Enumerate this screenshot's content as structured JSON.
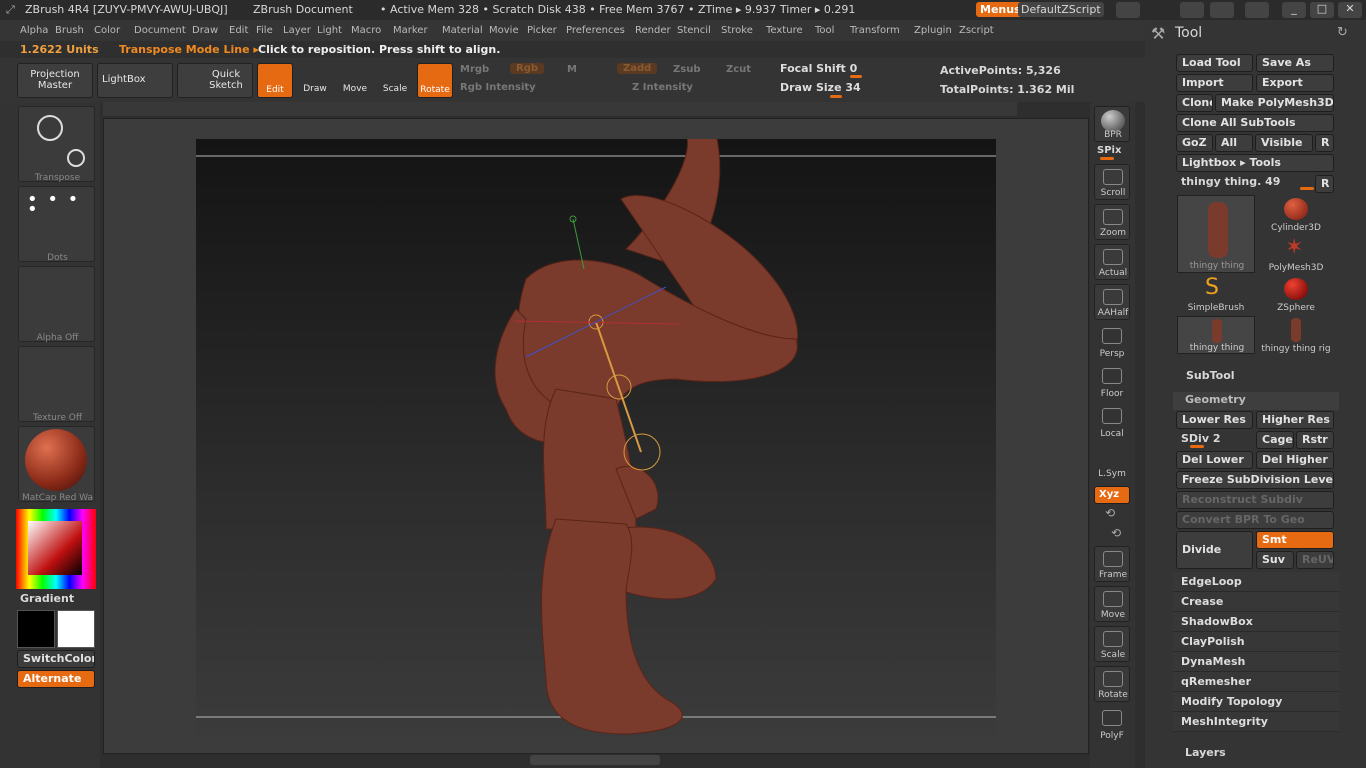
{
  "titlebar": {
    "app": "ZBrush 4R4 [ZUYV-PMVY-AWUJ-UBQJ]",
    "doc": "ZBrush Document",
    "status": "• Active Mem 328 • Scratch Disk 438 • Free Mem 3767 • ZTime ▸ 9.937 Timer ▸ 0.291",
    "menus": "Menus",
    "script": "DefaultZScript"
  },
  "menu": [
    "Alpha",
    "Brush",
    "Color",
    "Document",
    "Draw",
    "Edit",
    "File",
    "Layer",
    "Light",
    "Macro",
    "Marker",
    "Material",
    "Movie",
    "Picker",
    "Preferences",
    "Render",
    "Stencil",
    "Stroke",
    "Texture",
    "Tool",
    "Transform",
    "Zplugin",
    "Zscript"
  ],
  "info": {
    "units": "1.2622 Units",
    "mode": "Transpose Mode Line ▸",
    "msg": "Click to reposition. Press shift to align."
  },
  "toolbar": {
    "projection": "Projection Master",
    "lightbox": "LightBox",
    "quicksketch": "Quick Sketch",
    "edit": "Edit",
    "draw": "Draw",
    "move": "Move",
    "scale": "Scale",
    "rotate": "Rotate",
    "mrgb": "Mrgb",
    "rgb": "Rgb",
    "m": "M",
    "zadd": "Zadd",
    "zsub": "Zsub",
    "zcut": "Zcut",
    "rgbint": "Rgb Intensity",
    "zint": "Z Intensity",
    "focal": "Focal Shift 0",
    "drawsize": "Draw Size 34",
    "active": "ActivePoints: 5,326",
    "total": "TotalPoints: 1.362 Mil"
  },
  "left": {
    "transpose": "Transpose",
    "dots": "Dots",
    "alpha": "Alpha Off",
    "texture": "Texture Off",
    "matcap": "MatCap Red Wa",
    "gradient": "Gradient",
    "switch": "SwitchColor",
    "alternate": "Alternate"
  },
  "right": {
    "bpr": "BPR",
    "spix": "SPix",
    "scroll": "Scroll",
    "zoom": "Zoom",
    "actual": "Actual",
    "aahalf": "AAHalf",
    "persp": "Persp",
    "floor": "Floor",
    "local": "Local",
    "lsym": "L.Sym",
    "xyz": "Xyz",
    "frame": "Frame",
    "move": "Move",
    "scale": "Scale",
    "rotate": "Rotate",
    "polyf": "PolyF"
  },
  "panel": {
    "title": "Tool",
    "load": "Load Tool",
    "save": "Save As",
    "import": "Import",
    "export": "Export",
    "clone": "Clone",
    "makepm": "Make PolyMesh3D",
    "cloneall": "Clone All SubTools",
    "goz": "GoZ",
    "all": "All",
    "visible": "Visible",
    "r": "R",
    "lightbox": "Lightbox ▸ Tools",
    "current": "thingy thing. 49",
    "thumbs": [
      "thingy thing",
      "Cylinder3D",
      "PolyMesh3D",
      "SimpleBrush",
      "ZSphere",
      "thingy thing",
      "thingy thing rig"
    ],
    "subtool": "SubTool",
    "geometry": "Geometry",
    "lower": "Lower Res",
    "higher": "Higher Res",
    "sdiv": "SDiv 2",
    "cage": "Cage",
    "rstr": "Rstr",
    "dellower": "Del Lower",
    "delhigher": "Del Higher",
    "freeze": "Freeze SubDivision Levels",
    "reconstruct": "Reconstruct Subdiv",
    "convert": "Convert BPR To Geo",
    "divide": "Divide",
    "smt": "Smt",
    "suv": "Suv",
    "reuv": "ReUV",
    "list": [
      "EdgeLoop",
      "Crease",
      "ShadowBox",
      "ClayPolish",
      "DynaMesh",
      "qRemesher",
      "Modify Topology",
      "MeshIntegrity"
    ],
    "layers": "Layers"
  },
  "colors": {
    "accent": "#e66a12",
    "model": "#7a3a2c"
  }
}
